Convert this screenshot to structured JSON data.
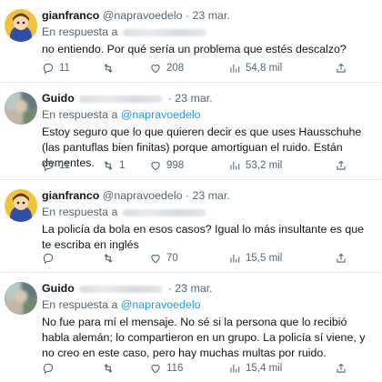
{
  "tweets": [
    {
      "name": "gianfranco",
      "handle": "@napravoedelo",
      "date": "· 23 mar.",
      "reply_prefix": "En respuesta a",
      "reply_to": "",
      "text": "no entiendo. Por qué sería un problema que estés descalzo?",
      "stats": {
        "replies": "11",
        "retweets": "",
        "likes": "208",
        "views": "54,8 mil"
      }
    },
    {
      "name": "Guido",
      "handle": "",
      "date": "· 23 mar.",
      "reply_prefix": "En respuesta a",
      "reply_to": "@napravoedelo",
      "text": "Estoy seguro que lo que quieren decir es que uses Hausschuhe (las pantuflas bien finitas) porque amortiguan el ruido. Están dementes.",
      "stats": {
        "replies": "11",
        "retweets": "1",
        "likes": "998",
        "views": "53,2 mil"
      }
    },
    {
      "name": "gianfranco",
      "handle": "@napravoedelo",
      "date": "· 23 mar.",
      "reply_prefix": "En respuesta a",
      "reply_to": "",
      "text": "La policía da bola en esos casos? Igual lo más insultante es que te escriba en inglés",
      "stats": {
        "replies": "",
        "retweets": "",
        "likes": "70",
        "views": "15,5 mil"
      }
    },
    {
      "name": "Guido",
      "handle": "",
      "date": "· 23 mar.",
      "reply_prefix": "En respuesta a",
      "reply_to": "@napravoedelo",
      "text": "No fue para mí el mensaje. No sé si la persona que lo recibió habla alemán; lo compartieron en un grupo. La policía sí viene, y no creo en este caso, pero hay muchas multas por ruido.",
      "stats": {
        "replies": "",
        "retweets": "",
        "likes": "116",
        "views": "15,4 mil"
      }
    }
  ],
  "colors": {
    "link": "#1d9bf0",
    "secondary_text": "#536471",
    "primary_text": "#0f1419",
    "divider": "#e6e9ec"
  },
  "icons": {
    "reply": "speech-bubble-icon",
    "retweet": "retweet-arrows-icon",
    "like": "heart-icon",
    "views": "bar-chart-icon",
    "share": "share-upload-icon"
  }
}
